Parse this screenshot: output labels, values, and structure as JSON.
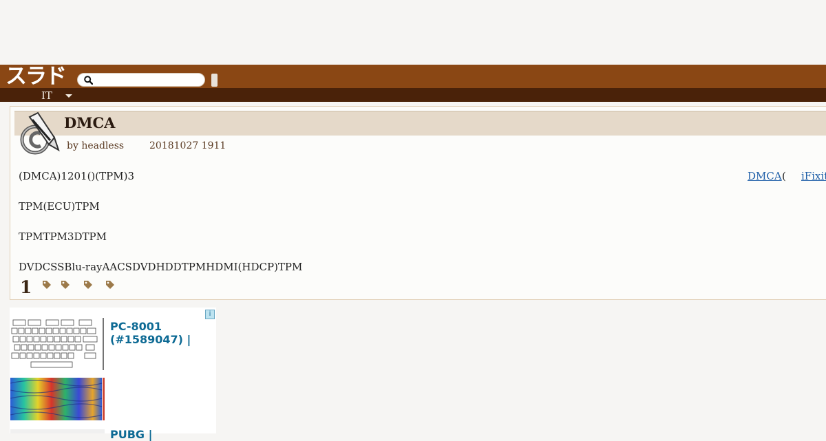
{
  "header": {
    "logo_text": "スラド",
    "search_placeholder": "",
    "section_label": "IT"
  },
  "article": {
    "title": "DMCA",
    "byline": "by headless",
    "date": "20181027 1911",
    "paragraphs": [
      "(DMCA)1201()(TPM)3",
      "TPM(ECU)TPM",
      "TPMTPM3DTPM",
      "DVDCSSBlu-rayAACSDVDHDDTPMHDMI(HDCP)TPM"
    ],
    "links": {
      "dmca": "DMCA",
      "paren": "(",
      "ifixit": "iFixit"
    },
    "comment_count": "1",
    "tag_icons": [
      "tag-icon",
      "tag-icon",
      "tag-icon",
      "tag-icon"
    ]
  },
  "ad": {
    "info_label": "i",
    "headline": "PC-8001 (#1589047) |",
    "headline2": "PUBG |"
  },
  "colors": {
    "header_brown": "#8a4714",
    "subbar_dark": "#4a2209",
    "title_bar": "#e5d9c9",
    "link_blue": "#1f5fa8",
    "ad_blue": "#0d6a94"
  }
}
